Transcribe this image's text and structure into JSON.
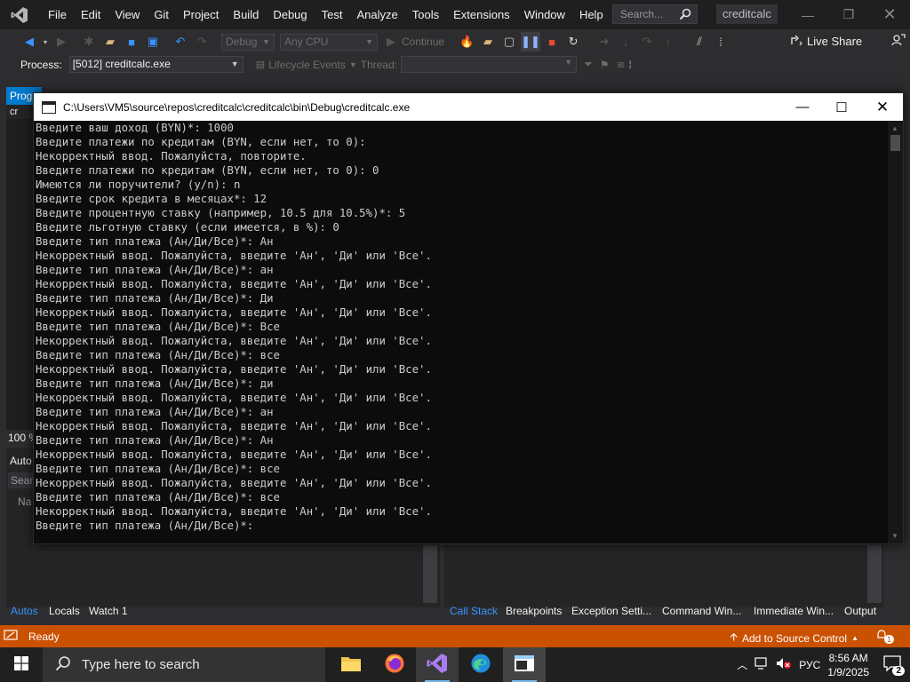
{
  "vs": {
    "menu": [
      "File",
      "Edit",
      "View",
      "Git",
      "Project",
      "Build",
      "Debug",
      "Test",
      "Analyze",
      "Tools",
      "Extensions",
      "Window",
      "Help"
    ],
    "search_placeholder": "Search...",
    "solution_name": "creditcalc",
    "accent_color": "#3794ff",
    "statusbar_color": "#ca5100"
  },
  "toolbar": {
    "config": "Debug",
    "platform": "Any CPU",
    "continue_label": "Continue",
    "live_share": "Live Share"
  },
  "procbar": {
    "process_label": "Process:",
    "process_value": "[5012] creditcalc.exe",
    "lifecycle_label": "Lifecycle Events",
    "thread_label": "Thread:"
  },
  "panels": {
    "left_title": "Progr",
    "left_item": "cr",
    "zoom": "100 %",
    "autos_title": "Auto",
    "search_label": "Searc",
    "name_col": "Na",
    "bottom_left_tabs": [
      "Autos",
      "Locals",
      "Watch 1"
    ],
    "bottom_right_tabs": [
      "Call Stack",
      "Breakpoints",
      "Exception Setti...",
      "Command Win...",
      "Immediate Win...",
      "Output"
    ]
  },
  "statusbar": {
    "ready": "Ready",
    "add_source": "Add to Source Control",
    "notifications": "1"
  },
  "taskbar": {
    "search_placeholder": "Type here to search",
    "language": "РУС",
    "time": "8:56 AM",
    "date": "1/9/2025",
    "notification_count": "2"
  },
  "console": {
    "title": "C:\\Users\\VM5\\source\\repos\\creditcalc\\creditcalc\\bin\\Debug\\creditcalc.exe",
    "lines": [
      "Введите ваш доход (BYN)*: 1000",
      "Введите платежи по кредитам (BYN, если нет, то 0):",
      "Некорректный ввод. Пожалуйста, повторите.",
      "Введите платежи по кредитам (BYN, если нет, то 0): 0",
      "Имеются ли поручители? (y/n): n",
      "Введите срок кредита в месяцах*: 12",
      "Введите процентную ставку (например, 10.5 для 10.5%)*: 5",
      "Введите льготную ставку (если имеется, в %): 0",
      "Введите тип платежа (Ан/Ди/Все)*: Ан",
      "Некорректный ввод. Пожалуйста, введите 'Ан', 'Ди' или 'Все'.",
      "Введите тип платежа (Ан/Ди/Все)*: ан",
      "Некорректный ввод. Пожалуйста, введите 'Ан', 'Ди' или 'Все'.",
      "Введите тип платежа (Ан/Ди/Все)*: Ди",
      "Некорректный ввод. Пожалуйста, введите 'Ан', 'Ди' или 'Все'.",
      "Введите тип платежа (Ан/Ди/Все)*: Все",
      "Некорректный ввод. Пожалуйста, введите 'Ан', 'Ди' или 'Все'.",
      "Введите тип платежа (Ан/Ди/Все)*: все",
      "Некорректный ввод. Пожалуйста, введите 'Ан', 'Ди' или 'Все'.",
      "Введите тип платежа (Ан/Ди/Все)*: ди",
      "Некорректный ввод. Пожалуйста, введите 'Ан', 'Ди' или 'Все'.",
      "Введите тип платежа (Ан/Ди/Все)*: ан",
      "Некорректный ввод. Пожалуйста, введите 'Ан', 'Ди' или 'Все'.",
      "Введите тип платежа (Ан/Ди/Все)*: Ан",
      "Некорректный ввод. Пожалуйста, введите 'Ан', 'Ди' или 'Все'.",
      "Введите тип платежа (Ан/Ди/Все)*: все",
      "Некорректный ввод. Пожалуйста, введите 'Ан', 'Ди' или 'Все'.",
      "Введите тип платежа (Ан/Ди/Все)*: все",
      "Некорректный ввод. Пожалуйста, введите 'Ан', 'Ди' или 'Все'.",
      "Введите тип платежа (Ан/Ди/Все)*:"
    ]
  }
}
